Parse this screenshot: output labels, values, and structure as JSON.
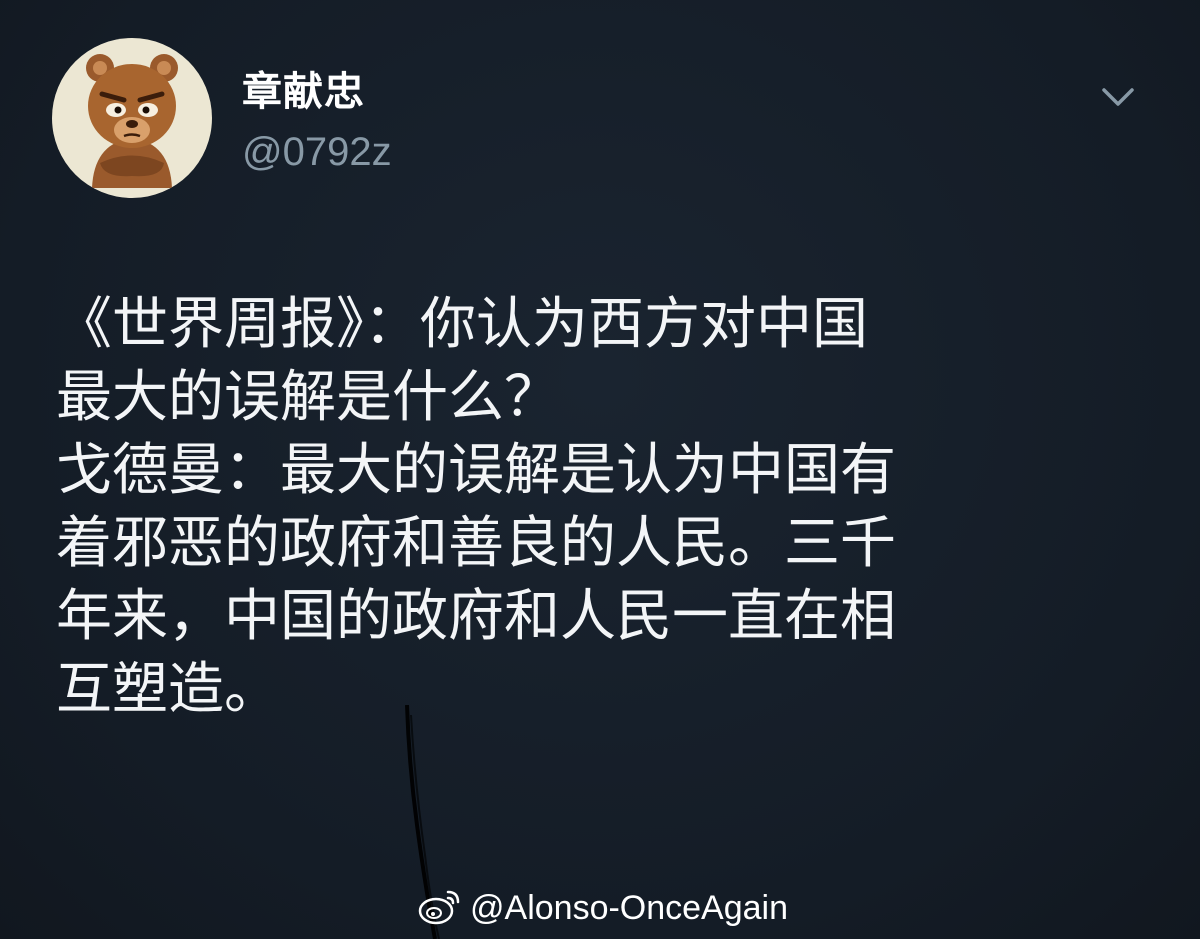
{
  "tweet": {
    "author": {
      "display_name": "章献忠",
      "handle": "@0792z",
      "avatar_icon": "cartoon-bear-avatar-icon"
    },
    "menu_icon": "chevron-down-icon",
    "lines": [
      "《世界周报》：你认为西方对中国",
      "最大的误解是什么？",
      "戈德曼：最大的误解是认为中国有",
      "着邪恶的政府和善良的人民。三千",
      "年来，中国的政府和人民一直在相",
      "互塑造。"
    ]
  },
  "watermark": {
    "icon": "weibo-icon",
    "text": "@Alonso-OnceAgain"
  },
  "colors": {
    "background": "#16202b",
    "text": "#f3f5f7",
    "handle": "#8899a6"
  }
}
